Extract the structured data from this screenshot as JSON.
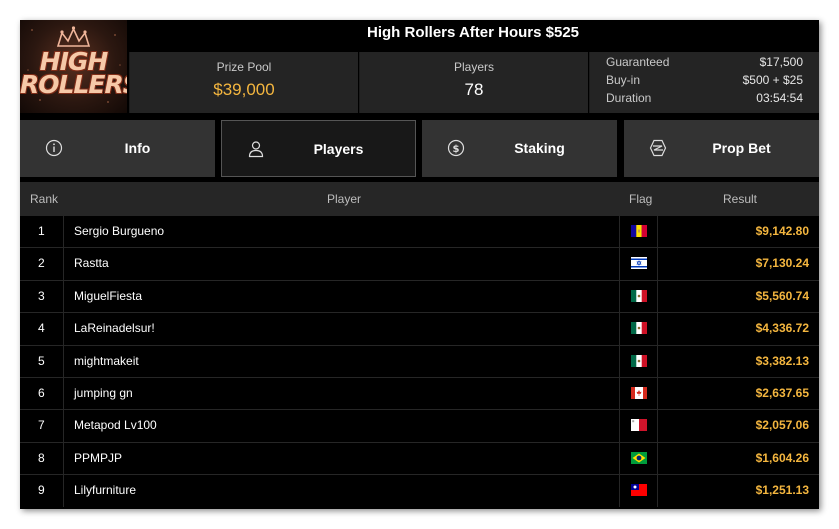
{
  "header": {
    "title": "High Rollers After Hours $525",
    "logo": {
      "line1": "HIGH",
      "line2": "ROLLERS"
    },
    "prize_pool": {
      "label": "Prize Pool",
      "value": "$39,000"
    },
    "players": {
      "label": "Players",
      "value": "78"
    },
    "details": [
      {
        "label": "Guaranteed",
        "value": "$17,500"
      },
      {
        "label": "Buy-in",
        "value": "$500 + $25"
      },
      {
        "label": "Duration",
        "value": "03:54:54"
      }
    ]
  },
  "tabs": [
    {
      "label": "Info",
      "icon": "info-icon"
    },
    {
      "label": "Players",
      "icon": "user-icon",
      "active": true
    },
    {
      "label": "Staking",
      "icon": "dollar-coin-icon"
    },
    {
      "label": "Prop Bet",
      "icon": "chip-icon"
    }
  ],
  "table": {
    "headers": {
      "rank": "Rank",
      "player": "Player",
      "flag": "Flag",
      "result": "Result"
    },
    "rows": [
      {
        "rank": "1",
        "player": "Sergio Burgueno",
        "flag": "andorra",
        "result": "$9,142.80"
      },
      {
        "rank": "2",
        "player": "Rastta",
        "flag": "israel",
        "result": "$7,130.24"
      },
      {
        "rank": "3",
        "player": "MiguelFiesta",
        "flag": "mexico",
        "result": "$5,560.74"
      },
      {
        "rank": "4",
        "player": "LaReinadelsur!",
        "flag": "mexico",
        "result": "$4,336.72"
      },
      {
        "rank": "5",
        "player": "mightmakeit",
        "flag": "mexico",
        "result": "$3,382.13"
      },
      {
        "rank": "6",
        "player": "jumping gn",
        "flag": "canada",
        "result": "$2,637.65"
      },
      {
        "rank": "7",
        "player": "Metapod Lv100",
        "flag": "malta",
        "result": "$2,057.06"
      },
      {
        "rank": "8",
        "player": "PPMPJP",
        "flag": "brazil",
        "result": "$1,604.26"
      },
      {
        "rank": "9",
        "player": "Lilyfurniture",
        "flag": "taiwan",
        "result": "$1,251.13"
      }
    ]
  },
  "colors": {
    "accent": "#f4b63f",
    "panel": "#242424",
    "tab": "#333333",
    "background": "#000000"
  }
}
